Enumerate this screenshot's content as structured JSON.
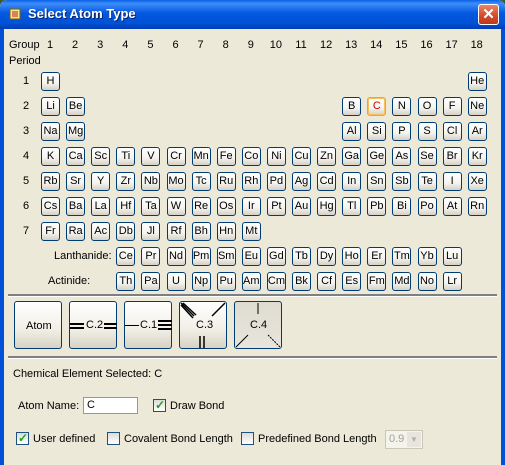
{
  "window": {
    "title": "Select Atom Type",
    "close_glyph": "✕"
  },
  "table": {
    "group_label": "Group",
    "period_label": "Period",
    "groups": [
      "1",
      "2",
      "3",
      "4",
      "5",
      "6",
      "7",
      "8",
      "9",
      "10",
      "11",
      "12",
      "13",
      "14",
      "15",
      "16",
      "17",
      "18"
    ],
    "periods": [
      "1",
      "2",
      "3",
      "4",
      "5",
      "6",
      "7"
    ],
    "lanthanide_label": "Lanthanide:",
    "actinide_label": "Actinide:",
    "selected": "C",
    "elements": [
      {
        "s": "H",
        "p": 1,
        "g": 1
      },
      {
        "s": "He",
        "p": 1,
        "g": 18
      },
      {
        "s": "Li",
        "p": 2,
        "g": 1
      },
      {
        "s": "Be",
        "p": 2,
        "g": 2
      },
      {
        "s": "B",
        "p": 2,
        "g": 13
      },
      {
        "s": "C",
        "p": 2,
        "g": 14
      },
      {
        "s": "N",
        "p": 2,
        "g": 15
      },
      {
        "s": "O",
        "p": 2,
        "g": 16
      },
      {
        "s": "F",
        "p": 2,
        "g": 17
      },
      {
        "s": "Ne",
        "p": 2,
        "g": 18
      },
      {
        "s": "Na",
        "p": 3,
        "g": 1
      },
      {
        "s": "Mg",
        "p": 3,
        "g": 2
      },
      {
        "s": "Al",
        "p": 3,
        "g": 13
      },
      {
        "s": "Si",
        "p": 3,
        "g": 14
      },
      {
        "s": "P",
        "p": 3,
        "g": 15
      },
      {
        "s": "S",
        "p": 3,
        "g": 16
      },
      {
        "s": "Cl",
        "p": 3,
        "g": 17
      },
      {
        "s": "Ar",
        "p": 3,
        "g": 18
      },
      {
        "s": "K",
        "p": 4,
        "g": 1
      },
      {
        "s": "Ca",
        "p": 4,
        "g": 2
      },
      {
        "s": "Sc",
        "p": 4,
        "g": 3
      },
      {
        "s": "Ti",
        "p": 4,
        "g": 4
      },
      {
        "s": "V",
        "p": 4,
        "g": 5
      },
      {
        "s": "Cr",
        "p": 4,
        "g": 6
      },
      {
        "s": "Mn",
        "p": 4,
        "g": 7
      },
      {
        "s": "Fe",
        "p": 4,
        "g": 8
      },
      {
        "s": "Co",
        "p": 4,
        "g": 9
      },
      {
        "s": "Ni",
        "p": 4,
        "g": 10
      },
      {
        "s": "Cu",
        "p": 4,
        "g": 11
      },
      {
        "s": "Zn",
        "p": 4,
        "g": 12
      },
      {
        "s": "Ga",
        "p": 4,
        "g": 13
      },
      {
        "s": "Ge",
        "p": 4,
        "g": 14
      },
      {
        "s": "As",
        "p": 4,
        "g": 15
      },
      {
        "s": "Se",
        "p": 4,
        "g": 16
      },
      {
        "s": "Br",
        "p": 4,
        "g": 17
      },
      {
        "s": "Kr",
        "p": 4,
        "g": 18
      },
      {
        "s": "Rb",
        "p": 5,
        "g": 1
      },
      {
        "s": "Sr",
        "p": 5,
        "g": 2
      },
      {
        "s": "Y",
        "p": 5,
        "g": 3
      },
      {
        "s": "Zr",
        "p": 5,
        "g": 4
      },
      {
        "s": "Nb",
        "p": 5,
        "g": 5
      },
      {
        "s": "Mo",
        "p": 5,
        "g": 6
      },
      {
        "s": "Tc",
        "p": 5,
        "g": 7
      },
      {
        "s": "Ru",
        "p": 5,
        "g": 8
      },
      {
        "s": "Rh",
        "p": 5,
        "g": 9
      },
      {
        "s": "Pd",
        "p": 5,
        "g": 10
      },
      {
        "s": "Ag",
        "p": 5,
        "g": 11
      },
      {
        "s": "Cd",
        "p": 5,
        "g": 12
      },
      {
        "s": "In",
        "p": 5,
        "g": 13
      },
      {
        "s": "Sn",
        "p": 5,
        "g": 14
      },
      {
        "s": "Sb",
        "p": 5,
        "g": 15
      },
      {
        "s": "Te",
        "p": 5,
        "g": 16
      },
      {
        "s": "I",
        "p": 5,
        "g": 17
      },
      {
        "s": "Xe",
        "p": 5,
        "g": 18
      },
      {
        "s": "Cs",
        "p": 6,
        "g": 1
      },
      {
        "s": "Ba",
        "p": 6,
        "g": 2
      },
      {
        "s": "La",
        "p": 6,
        "g": 3
      },
      {
        "s": "Hf",
        "p": 6,
        "g": 4
      },
      {
        "s": "Ta",
        "p": 6,
        "g": 5
      },
      {
        "s": "W",
        "p": 6,
        "g": 6
      },
      {
        "s": "Re",
        "p": 6,
        "g": 7
      },
      {
        "s": "Os",
        "p": 6,
        "g": 8
      },
      {
        "s": "Ir",
        "p": 6,
        "g": 9
      },
      {
        "s": "Pt",
        "p": 6,
        "g": 10
      },
      {
        "s": "Au",
        "p": 6,
        "g": 11
      },
      {
        "s": "Hg",
        "p": 6,
        "g": 12
      },
      {
        "s": "Tl",
        "p": 6,
        "g": 13
      },
      {
        "s": "Pb",
        "p": 6,
        "g": 14
      },
      {
        "s": "Bi",
        "p": 6,
        "g": 15
      },
      {
        "s": "Po",
        "p": 6,
        "g": 16
      },
      {
        "s": "At",
        "p": 6,
        "g": 17
      },
      {
        "s": "Rn",
        "p": 6,
        "g": 18
      },
      {
        "s": "Fr",
        "p": 7,
        "g": 1
      },
      {
        "s": "Ra",
        "p": 7,
        "g": 2
      },
      {
        "s": "Ac",
        "p": 7,
        "g": 3
      },
      {
        "s": "Db",
        "p": 7,
        "g": 4
      },
      {
        "s": "Jl",
        "p": 7,
        "g": 5
      },
      {
        "s": "Rf",
        "p": 7,
        "g": 6
      },
      {
        "s": "Bh",
        "p": 7,
        "g": 7
      },
      {
        "s": "Hn",
        "p": 7,
        "g": 8
      },
      {
        "s": "Mt",
        "p": 7,
        "g": 9
      }
    ],
    "lanthanides": [
      "Ce",
      "Pr",
      "Nd",
      "Pm",
      "Sm",
      "Eu",
      "Gd",
      "Tb",
      "Dy",
      "Ho",
      "Er",
      "Tm",
      "Yb",
      "Lu"
    ],
    "actinides": [
      "Th",
      "Pa",
      "U",
      "Np",
      "Pu",
      "Am",
      "Cm",
      "Bk",
      "Cf",
      "Es",
      "Fm",
      "Md",
      "No",
      "Lr"
    ]
  },
  "atom_types": [
    {
      "label": "Atom",
      "icon": "atom-icon"
    },
    {
      "label": "C.2",
      "icon": "double-bond-icon"
    },
    {
      "label": "C.1",
      "icon": "triple-bond-icon"
    },
    {
      "label": "C.3",
      "icon": "tetrahedral-icon"
    },
    {
      "label": "C.4",
      "icon": "sp3-icon",
      "active": true
    }
  ],
  "info": {
    "selected_text": "Chemical Element Selected: C"
  },
  "form": {
    "atom_name_label": "Atom Name:",
    "atom_name_value": "C",
    "draw_bond_label": "Draw Bond",
    "draw_bond_checked": true,
    "user_defined_label": "User defined",
    "user_defined_checked": true,
    "covalent_label": "Covalent Bond Length",
    "covalent_checked": false,
    "predefined_label": "Predefined Bond Length",
    "predefined_checked": false,
    "bond_length_value": "0.9"
  },
  "colors": {
    "title_blue": "#0052d6",
    "selected_text": "#d40000",
    "check_green": "#21a121"
  }
}
